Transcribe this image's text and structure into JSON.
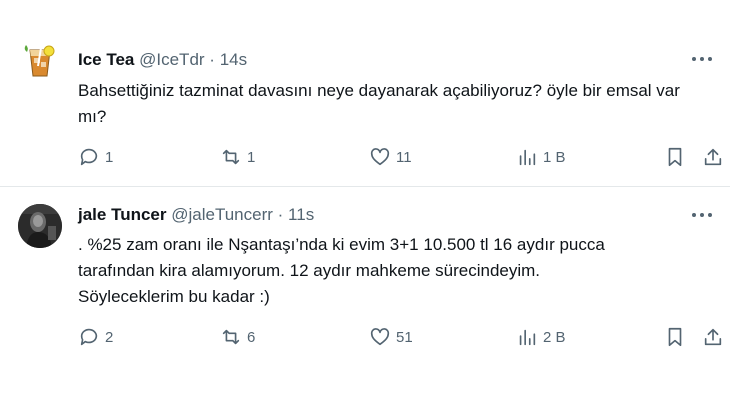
{
  "tweets": [
    {
      "name": "Ice Tea",
      "handle": "@IceTdr",
      "separator": "·",
      "time": "14s",
      "text": "Bahsettiğiniz tazminat davasını neye dayanarak açabiliyoruz? öyle bir emsal var mı?",
      "replies": "1",
      "reposts": "1",
      "likes": "11",
      "views": "1 B",
      "avatar_icon": "iced-tea-glass-icon"
    },
    {
      "name": "jale Tuncer",
      "handle": "@jaleTuncerr",
      "separator": "·",
      "time": "11s",
      "text": ". %25 zam oranı ile Nşantaşı’nda ki evim 3+1 10.500 tl 16 aydır pucca\ntarafından  kira alamıyorum. 12 aydır mahkeme sürecindeyim.\nSöyleceklerim bu kadar :)",
      "replies": "2",
      "reposts": "6",
      "likes": "51",
      "views": "2 B",
      "avatar_icon": "profile-photo"
    }
  ],
  "colors": {
    "text": "#0f1419",
    "muted": "#536471",
    "divider": "#e4e8ea"
  }
}
